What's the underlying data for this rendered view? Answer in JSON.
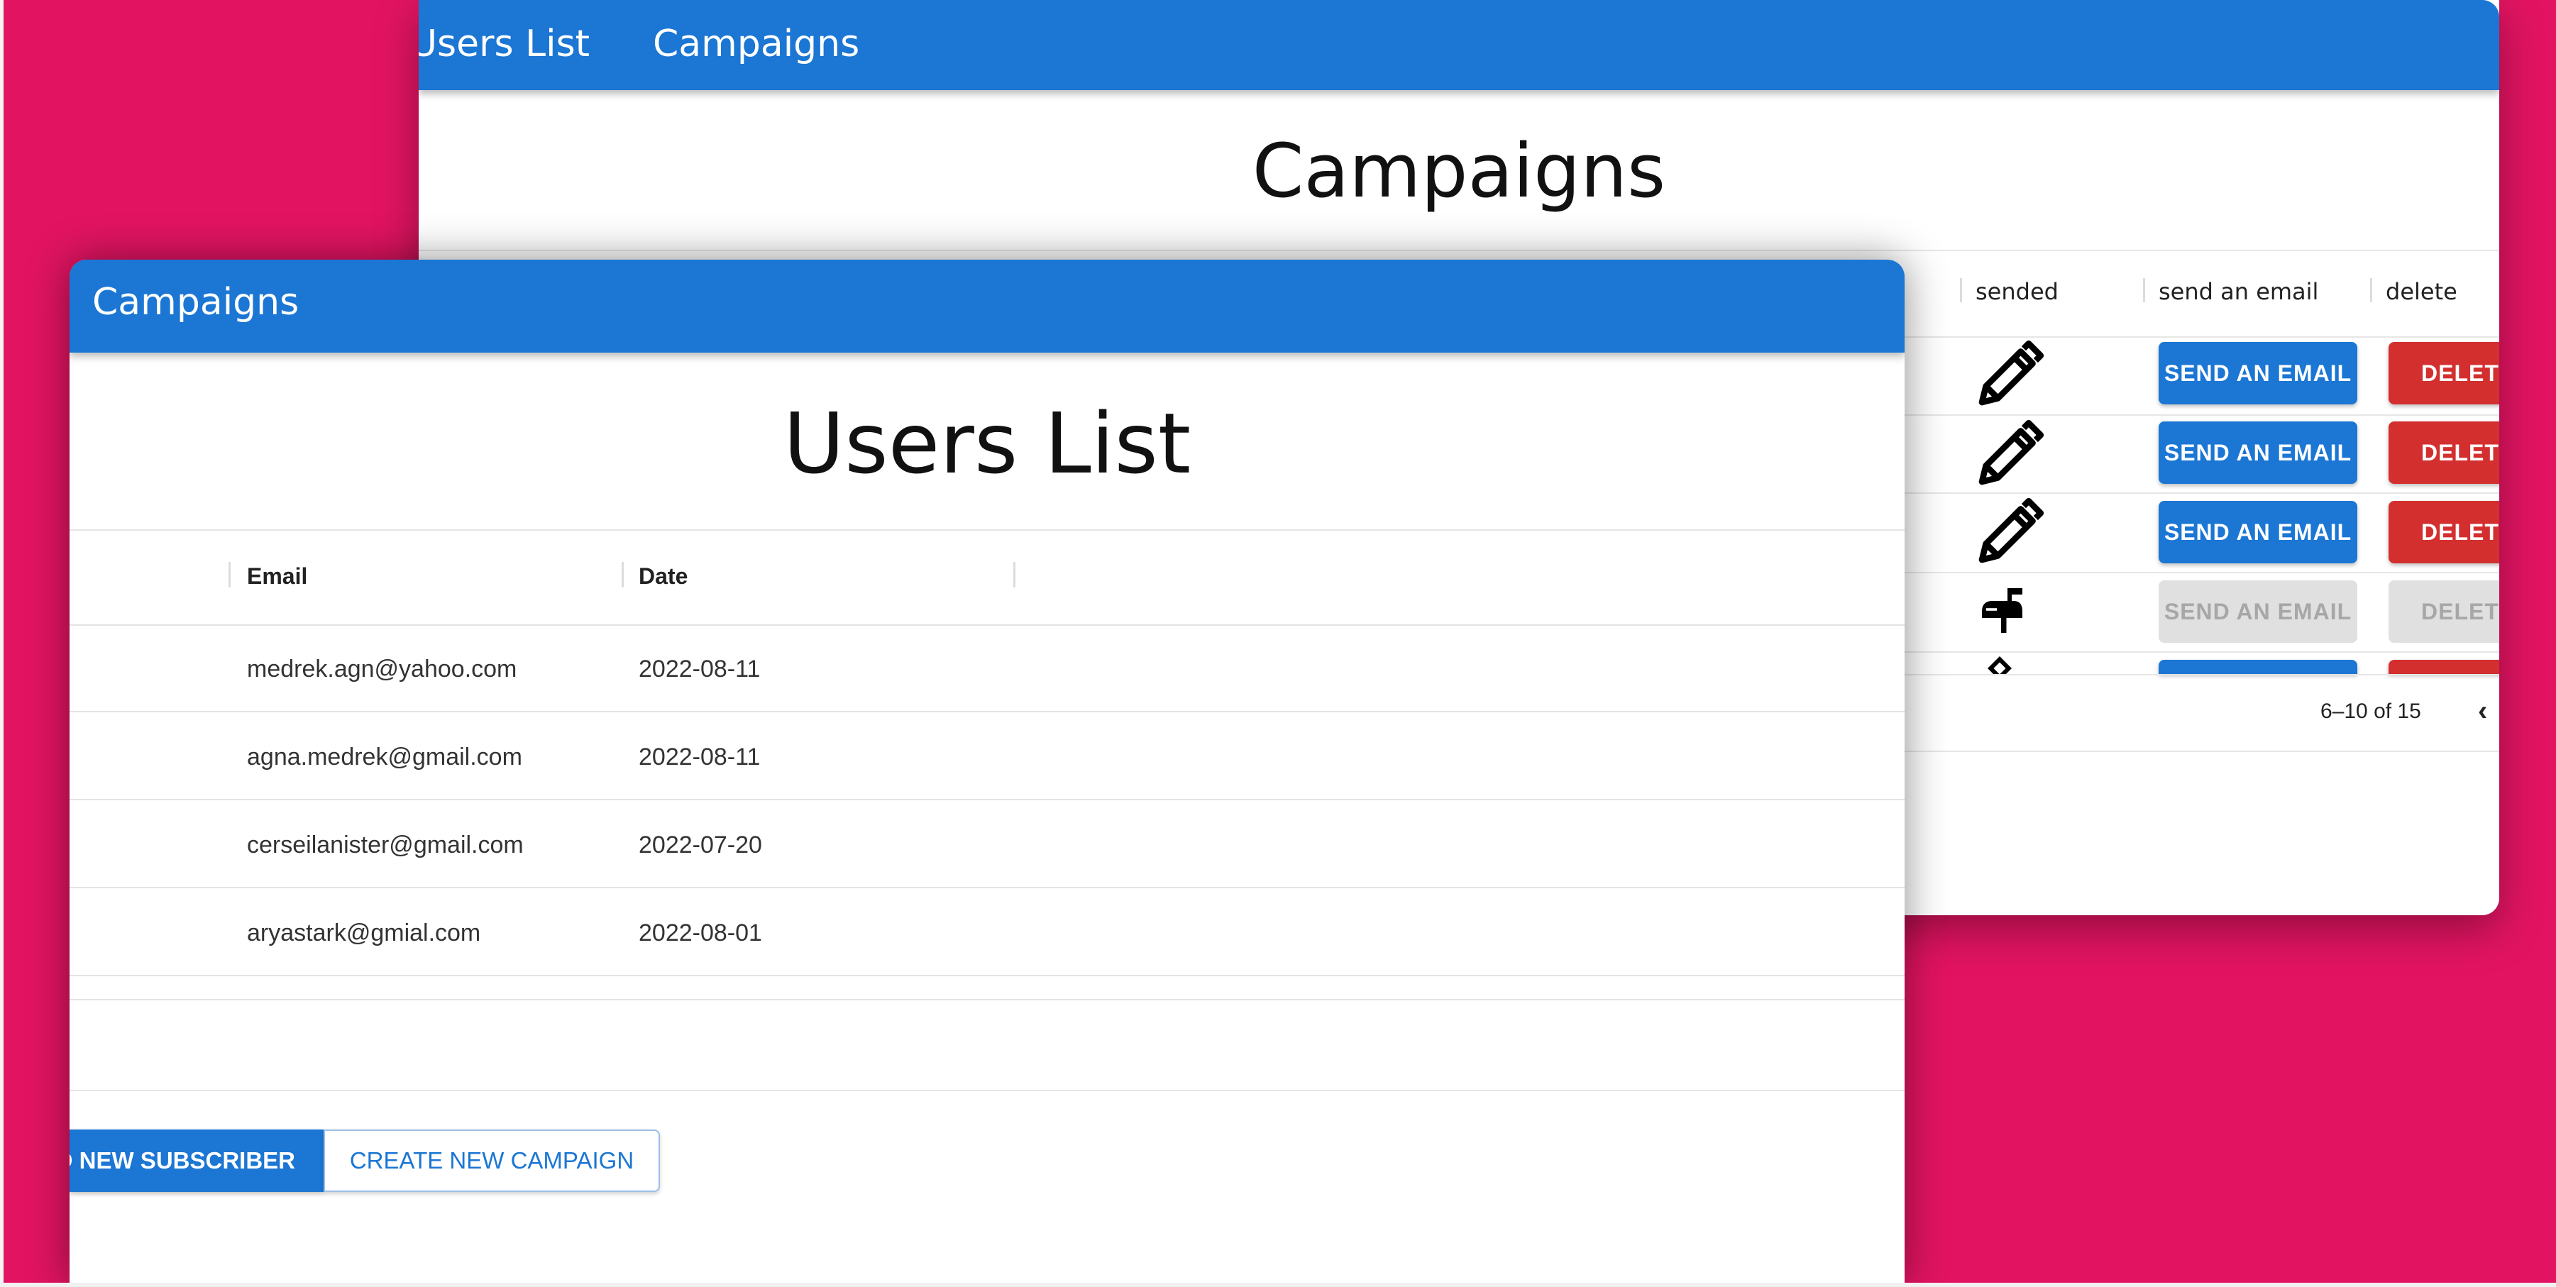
{
  "back_window": {
    "nav": {
      "users_list": "Users List",
      "campaigns": "Campaigns"
    },
    "title": "Campaigns",
    "columns": {
      "sended": "sended",
      "send_an_email": "send an email",
      "delete": "delete"
    },
    "rows": [
      {
        "sended_icon": "pencil-icon",
        "send_label": "SEND AN EMAIL",
        "delete_label": "DELETE",
        "disabled": false
      },
      {
        "sended_icon": "pencil-icon",
        "send_label": "SEND AN EMAIL",
        "delete_label": "DELETE",
        "disabled": false
      },
      {
        "sended_icon": "pencil-icon",
        "send_label": "SEND AN EMAIL",
        "delete_label": "DELETE",
        "disabled": false
      },
      {
        "sended_icon": "mailbox-icon",
        "send_label": "SEND AN EMAIL",
        "delete_label": "DELETE",
        "disabled": true
      }
    ],
    "pagination": "6–10 of 15"
  },
  "front_window": {
    "nav": {
      "campaigns": "Campaigns"
    },
    "title": "Users List",
    "columns": {
      "email": "Email",
      "date": "Date"
    },
    "rows": [
      {
        "email": "medrek.agn@yahoo.com",
        "date": "2022-08-11"
      },
      {
        "email": "agna.medrek@gmail.com",
        "date": "2022-08-11"
      },
      {
        "email": "cerseilanister@gmail.com",
        "date": "2022-07-20"
      },
      {
        "email": "aryastark@gmial.com",
        "date": "2022-08-01"
      }
    ],
    "buttons": {
      "add_subscriber": "ADD NEW SUBSCRIBER",
      "create_campaign": "CREATE NEW CAMPAIGN"
    }
  },
  "colors": {
    "background": "#e21462",
    "primary": "#1b76d4",
    "danger": "#d32f2f"
  }
}
